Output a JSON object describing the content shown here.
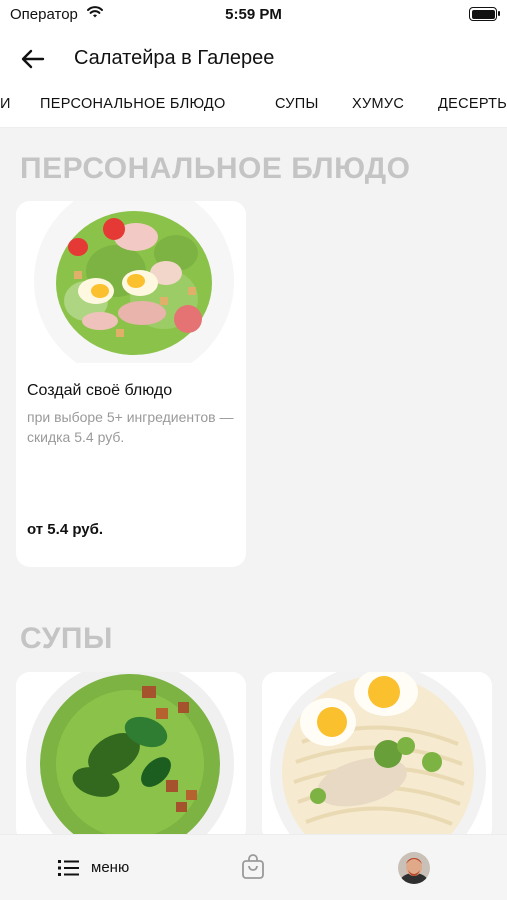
{
  "status_bar": {
    "carrier": "Оператор",
    "time": "5:59 PM"
  },
  "header": {
    "title": "Салатейра в Галерее",
    "back_icon": "arrow-left-icon"
  },
  "category_tabs": [
    {
      "label": "И"
    },
    {
      "label": "ПЕРСОНАЛЬНОЕ БЛЮДО"
    },
    {
      "label": "СУПЫ"
    },
    {
      "label": "ХУМУС"
    },
    {
      "label": "ДЕСЕРТЫ"
    }
  ],
  "sections": [
    {
      "title": "ПЕРСОНАЛЬНОЕ БЛЮДО",
      "items": [
        {
          "name": "Создай своё блюдо",
          "description": "при выборе 5+ ингредиентов — скидка 5.4 руб.",
          "price": "от 5.4 руб.",
          "image": "caesar-salad-image"
        }
      ]
    },
    {
      "title": "СУПЫ",
      "items": [
        {
          "image": "green-soup-image"
        },
        {
          "image": "noodle-soup-image"
        }
      ]
    }
  ],
  "bottom_nav": {
    "menu_label": "меню",
    "menu_icon": "list-icon",
    "cart_icon": "shopping-bag-icon",
    "profile_icon": "avatar-icon"
  },
  "colors": {
    "section_title": "#c4c4c4",
    "background": "#f3f3f3",
    "card": "#ffffff"
  }
}
